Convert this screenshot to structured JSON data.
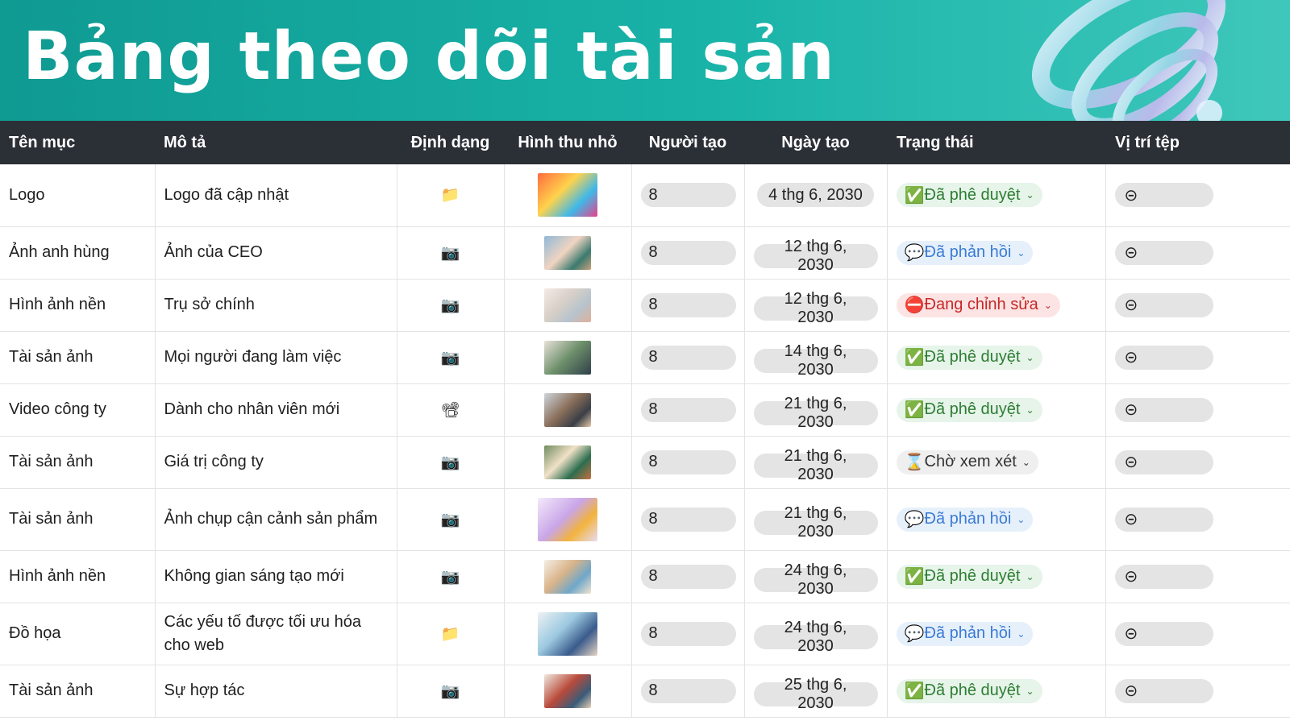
{
  "title": "Bảng theo dõi tài sản",
  "columns": [
    "Tên mục",
    "Mô tả",
    "Định dạng",
    "Hình thu nhỏ",
    "Người tạo",
    "Ngày tạo",
    "Trạng thái",
    "Vị trí tệp"
  ],
  "icons": {
    "folder": "📁",
    "camera": "📷",
    "video": "📽",
    "person": "8",
    "link": "⊝",
    "chevron": "⌄",
    "approved": "✅",
    "feedback": "💬",
    "editing": "⛔",
    "pending": "⌛"
  },
  "rows": [
    {
      "name": "Logo",
      "desc": "Logo đã cập nhật",
      "format": "📁",
      "date": "4 thg 6, 2030",
      "status": "Đã phê duyệt",
      "status_icon": "✅"
    },
    {
      "name": "Ảnh anh hùng",
      "desc": "Ảnh của CEO",
      "format": "📷",
      "date": "12 thg 6, 2030",
      "status": "Đã phản hồi",
      "status_icon": "💬"
    },
    {
      "name": "Hình ảnh nền",
      "desc": "Trụ sở chính",
      "format": "📷",
      "date": "12 thg 6, 2030",
      "status": "Đang chỉnh sửa",
      "status_icon": "⛔"
    },
    {
      "name": "Tài sản ảnh",
      "desc": "Mọi người đang làm việc",
      "format": "📷",
      "date": "14 thg 6, 2030",
      "status": "Đã phê duyệt",
      "status_icon": "✅"
    },
    {
      "name": "Video công ty",
      "desc": "Dành cho nhân viên mới",
      "format": "📽",
      "date": "21 thg 6, 2030",
      "status": "Đã phê duyệt",
      "status_icon": "✅"
    },
    {
      "name": "Tài sản ảnh",
      "desc": "Giá trị công ty",
      "format": "📷",
      "date": "21 thg 6, 2030",
      "status": "Chờ xem xét",
      "status_icon": "⌛"
    },
    {
      "name": "Tài sản ảnh",
      "desc": "Ảnh chụp cận cảnh sản phẩm",
      "format": "📷",
      "date": "21 thg 6, 2030",
      "status": "Đã phản hồi",
      "status_icon": "💬"
    },
    {
      "name": "Hình ảnh nền",
      "desc": "Không gian sáng tạo mới",
      "format": "📷",
      "date": "24 thg 6, 2030",
      "status": "Đã phê duyệt",
      "status_icon": "✅"
    },
    {
      "name": "Đồ họa",
      "desc": "Các yếu tố được tối ưu hóa cho web",
      "format": "📁",
      "date": "24 thg 6, 2030",
      "status": "Đã phản hồi",
      "status_icon": "💬"
    },
    {
      "name": "Tài sản ảnh",
      "desc": "Sự hợp tác",
      "format": "📷",
      "date": "25 thg 6, 2030",
      "status": "Đã phê duyệt",
      "status_icon": "✅"
    }
  ],
  "colors": {
    "banner": "#19b3a8",
    "header": "#2b2f36",
    "approved": "#2e7d32",
    "feedback": "#3a7bd5",
    "editing": "#c62828"
  }
}
